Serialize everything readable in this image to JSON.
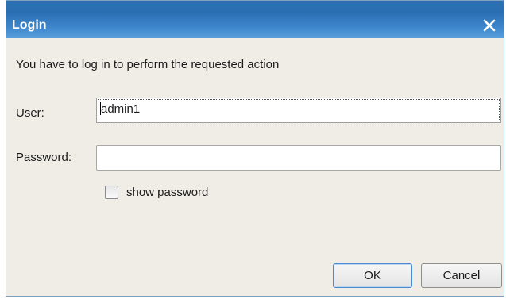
{
  "dialog": {
    "title": "Login",
    "message": "You have to log in to perform the requested action",
    "close_icon": "close-icon"
  },
  "form": {
    "user_label": "User:",
    "user_value": "admin1",
    "password_label": "Password:",
    "password_value": "",
    "show_password_label": "show password",
    "show_password_checked": false
  },
  "buttons": {
    "ok_label": "OK",
    "cancel_label": "Cancel"
  },
  "colors": {
    "titlebar": "#2d72b6",
    "window_bg": "#efede6",
    "focus_border": "#4a8bd0"
  }
}
